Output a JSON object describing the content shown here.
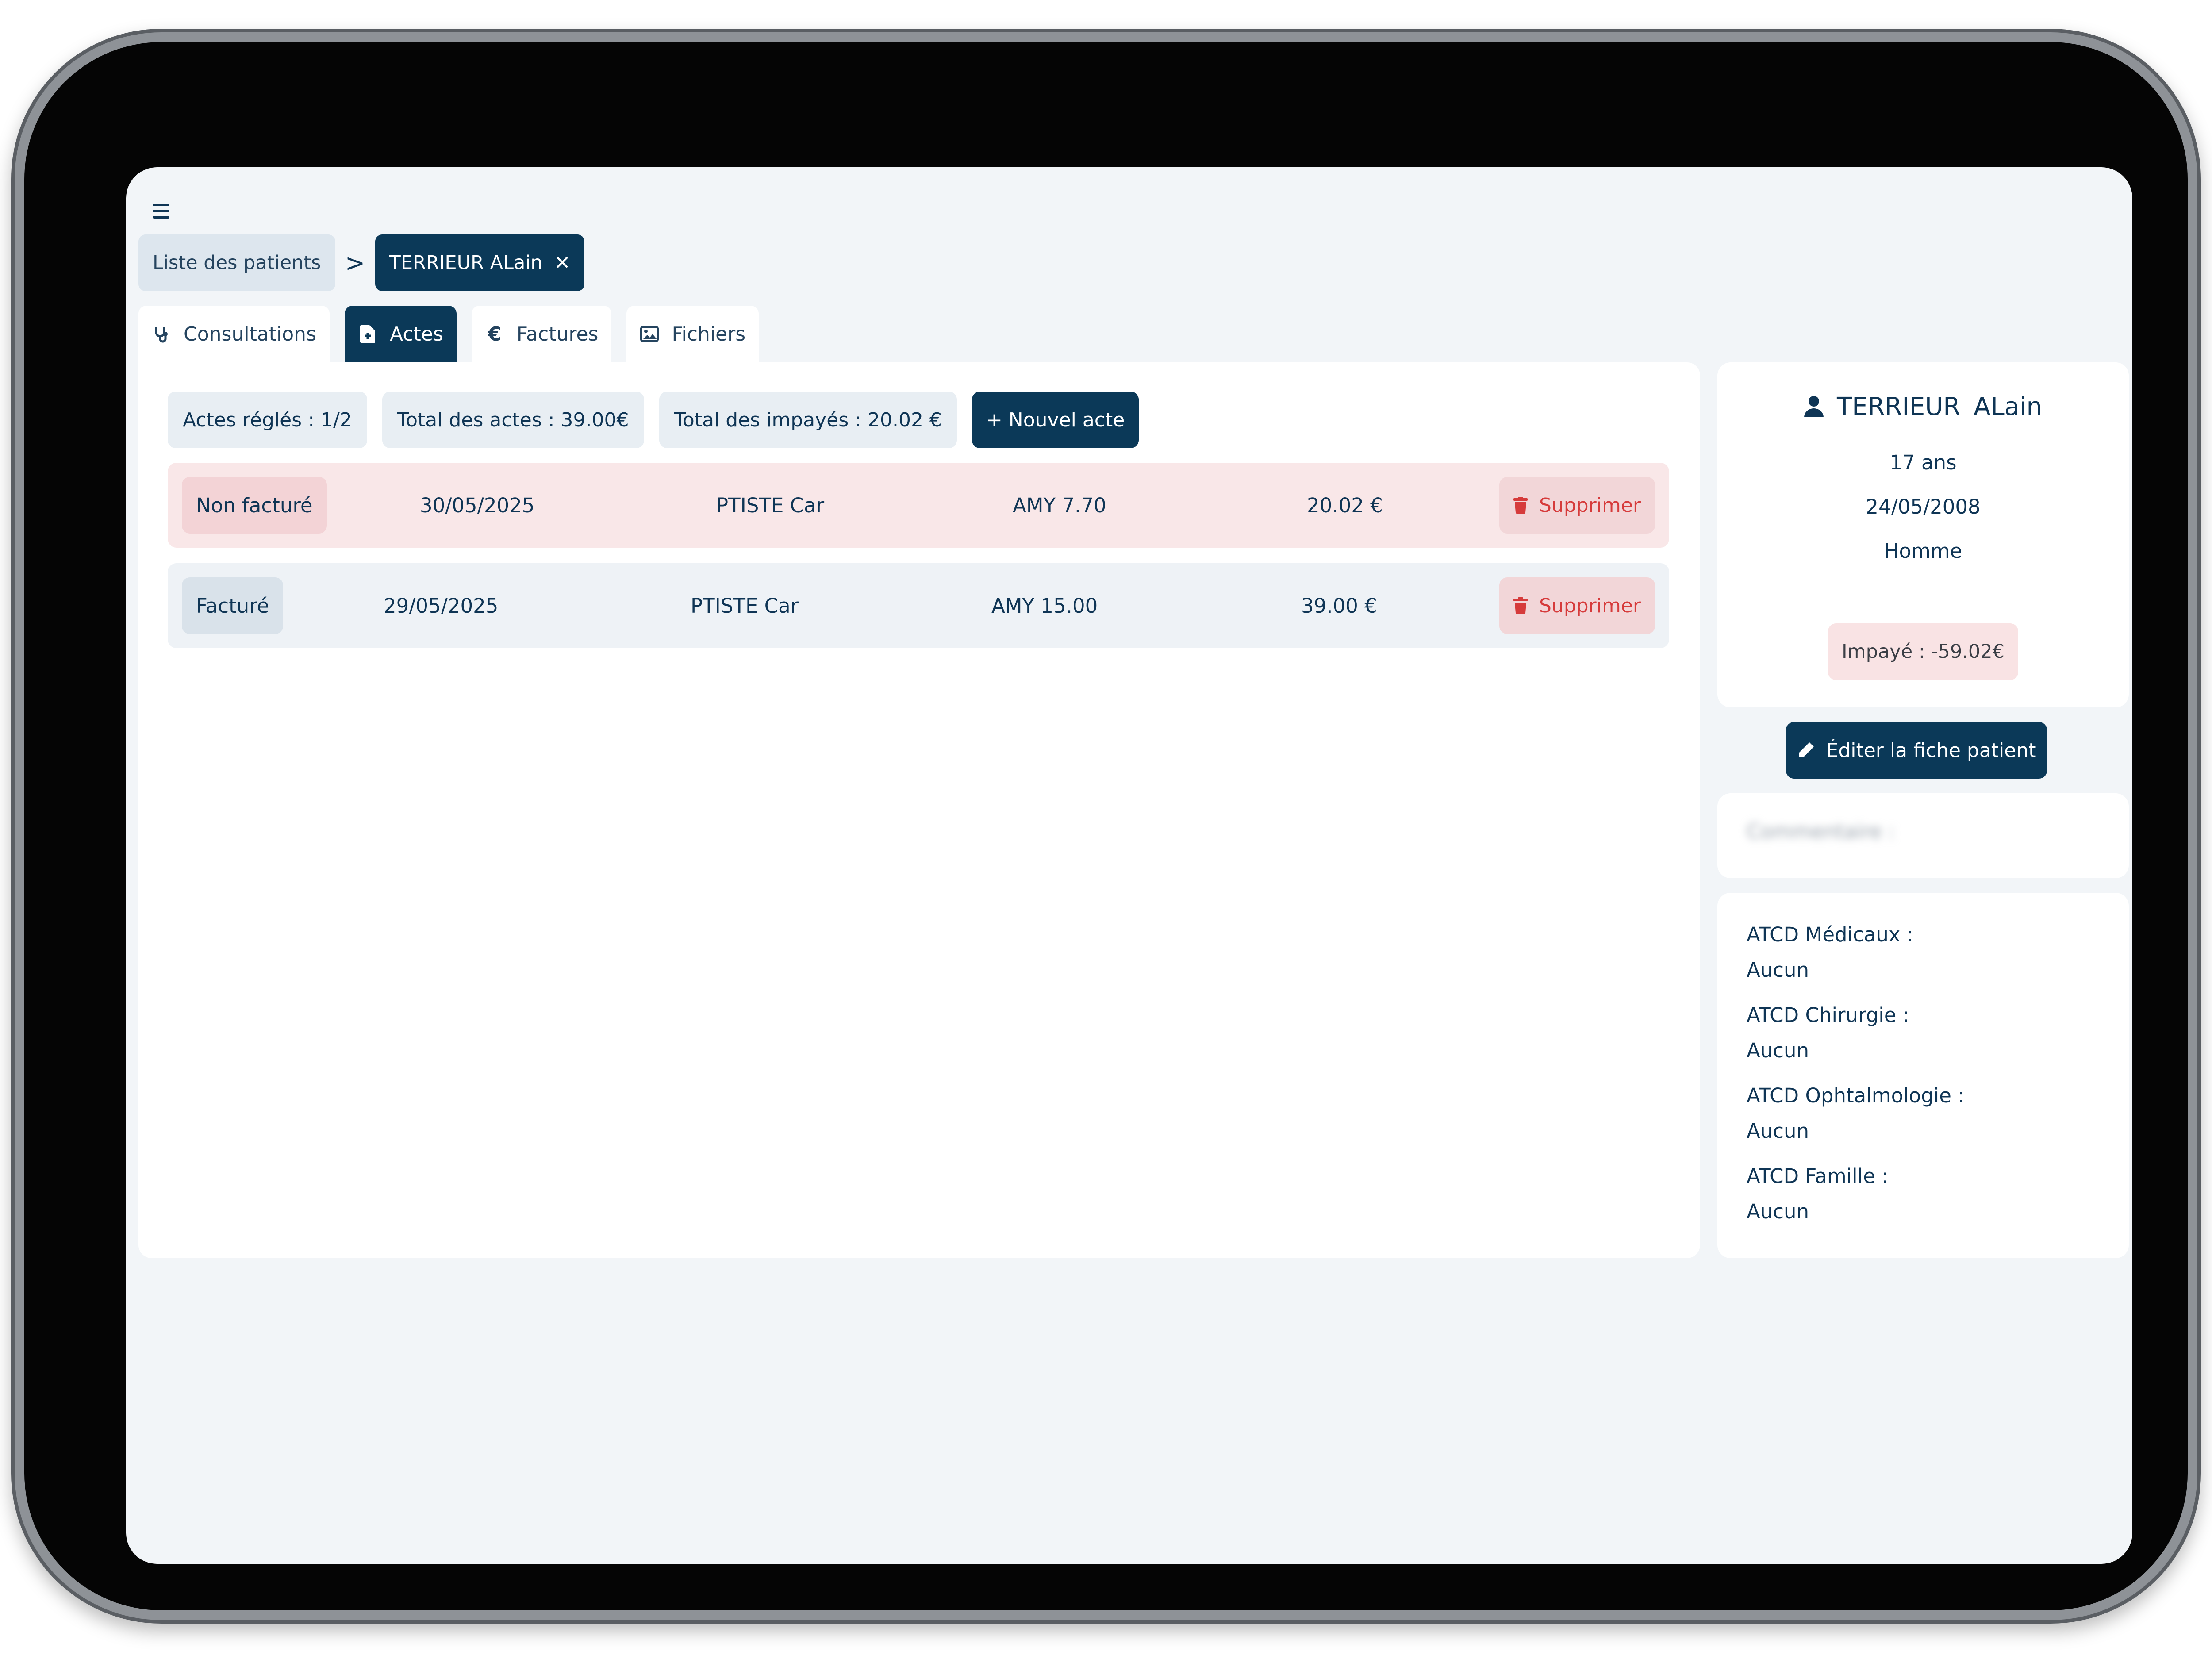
{
  "header": {
    "menu_icon": "menu-icon"
  },
  "breadcrumb": {
    "root_label": "Liste des patients",
    "separator": ">",
    "active_label": "TERRIEUR ALain",
    "close_glyph": "✕"
  },
  "tabs": [
    {
      "label": "Consultations",
      "icon": "stethoscope-icon",
      "active": false
    },
    {
      "label": "Actes",
      "icon": "file-medical-icon",
      "active": true
    },
    {
      "label": "Factures",
      "icon": "euro-icon",
      "active": false
    },
    {
      "label": "Fichiers",
      "icon": "image-icon",
      "active": false
    }
  ],
  "summary": {
    "acts_paid": "Actes réglés : 1/2",
    "acts_total": "Total des actes : 39.00€",
    "unpaid_total": "Total des impayés : 20.02 €",
    "new_act_label": "+ Nouvel acte"
  },
  "acts": [
    {
      "status": "Non facturé",
      "date": "30/05/2025",
      "practitioner": "PTISTE Car",
      "code": "AMY 7.70",
      "amount": "20.02 €",
      "delete_label": "Supprimer"
    },
    {
      "status": "Facturé",
      "date": "29/05/2025",
      "practitioner": "PTISTE Car",
      "code": "AMY 15.00",
      "amount": "39.00 €",
      "delete_label": "Supprimer"
    }
  ],
  "patient": {
    "last_name": "TERRIEUR",
    "first_name": "ALain",
    "age": "17 ans",
    "birth_date": "24/05/2008",
    "sex": "Homme",
    "unpaid": "Impayé : -59.02€"
  },
  "edit_button_label": "Éditer la fiche patient",
  "comment_label": "Commentaire :",
  "atcd": [
    {
      "title": "ATCD Médicaux :",
      "value": "Aucun"
    },
    {
      "title": "ATCD Chirurgie :",
      "value": "Aucun"
    },
    {
      "title": "ATCD Ophtalmologie :",
      "value": "Aucun"
    },
    {
      "title": "ATCD Famille :",
      "value": "Aucun"
    }
  ],
  "colors": {
    "primary": "#0b3958",
    "text": "#0f3555",
    "unbilled_row": "#f9e7e8",
    "billed_row": "#eef2f6",
    "danger": "#d63b3b",
    "background": "#f2f5f8"
  }
}
